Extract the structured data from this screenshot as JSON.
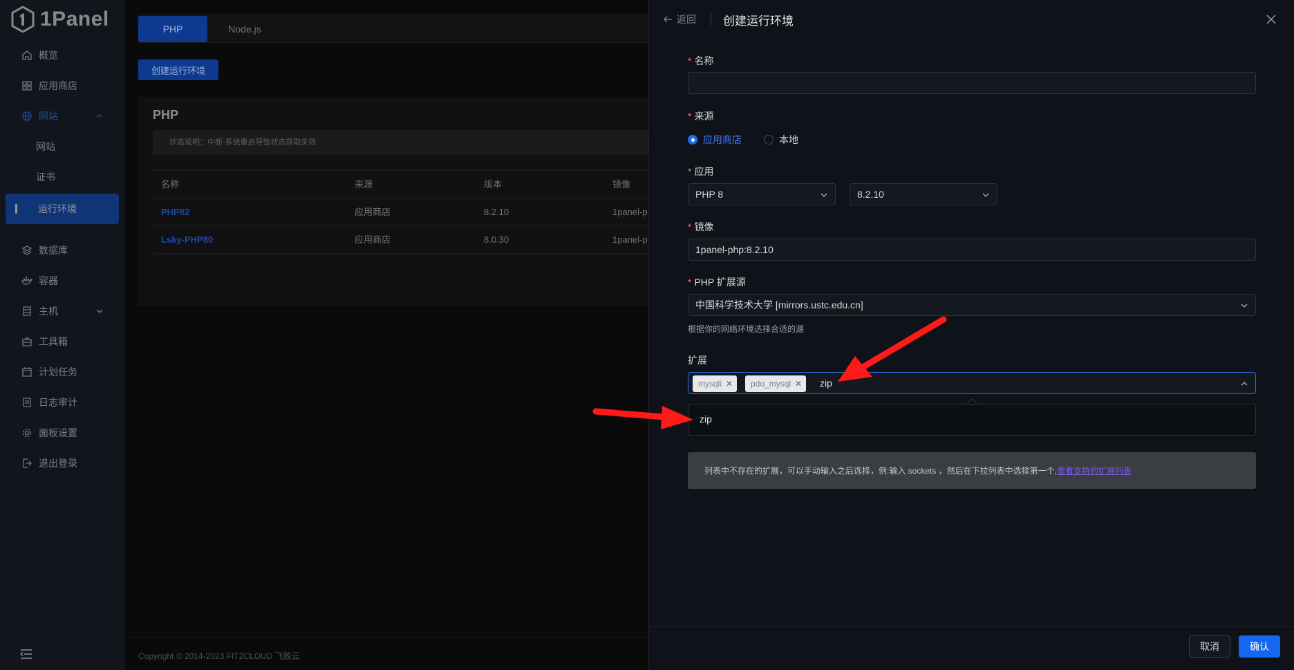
{
  "sidebar": {
    "logo_text": "1Panel",
    "items": [
      {
        "label": "概览",
        "icon": "home-icon"
      },
      {
        "label": "应用商店",
        "icon": "apps-grid-icon"
      },
      {
        "label": "网站",
        "icon": "globe-icon"
      },
      {
        "label": "网站",
        "icon": ""
      },
      {
        "label": "证书",
        "icon": ""
      },
      {
        "label": "运行环境",
        "icon": ""
      },
      {
        "label": "数据库",
        "icon": "layers-icon"
      },
      {
        "label": "容器",
        "icon": "docker-icon"
      },
      {
        "label": "主机",
        "icon": "server-icon"
      },
      {
        "label": "工具箱",
        "icon": "toolbox-icon"
      },
      {
        "label": "计划任务",
        "icon": "calendar-icon"
      },
      {
        "label": "日志审计",
        "icon": "log-icon"
      },
      {
        "label": "面板设置",
        "icon": "gear-icon"
      },
      {
        "label": "退出登录",
        "icon": "logout-icon"
      }
    ]
  },
  "main": {
    "tabs": [
      "PHP",
      "Node.js"
    ],
    "create_button": "创建运行环境",
    "card_title": "PHP",
    "notice": "状态说明：中断-系统重启导致状态获取失败",
    "columns": [
      "名称",
      "来源",
      "版本",
      "镜像"
    ],
    "rows": [
      {
        "name": "PHP82",
        "source": "应用商店",
        "version": "8.2.10",
        "image": "1panel-p"
      },
      {
        "name": "Lsky-PHP80",
        "source": "应用商店",
        "version": "8.0.30",
        "image": "1panel-p"
      }
    ],
    "copyright": "Copyright © 2014-2023 FIT2CLOUD 飞致云"
  },
  "drawer": {
    "back_label": "返回",
    "title": "创建运行环境",
    "name_label": "名称",
    "name_value": "",
    "source_label": "来源",
    "source_options": [
      "应用商店",
      "本地"
    ],
    "source_selected": "应用商店",
    "app_label": "应用",
    "app_value": "PHP 8",
    "version_value": "8.2.10",
    "image_label": "镜像",
    "image_value": "1panel-php:8.2.10",
    "ext_source_label": "PHP 扩展源",
    "ext_source_value": "中国科学技术大学 [mirrors.ustc.edu.cn]",
    "ext_source_hint": "根据你的网络环境选择合适的源",
    "extensions_label": "扩展",
    "extension_tags": [
      "mysqli",
      "pdo_mysql"
    ],
    "extension_query": "zip",
    "dropdown_options": [
      "zip"
    ],
    "info_text": "列表中不存在的扩展，可以手动输入之后选择，例:输入 sockets ，然后在下拉列表中选择第一个,",
    "info_link": "查看支持的扩展列表",
    "cancel_label": "取消",
    "confirm_label": "确认"
  },
  "colors": {
    "primary": "#1667f0",
    "required": "#f56c6c",
    "annotation_arrow": "#ff1a1a"
  }
}
